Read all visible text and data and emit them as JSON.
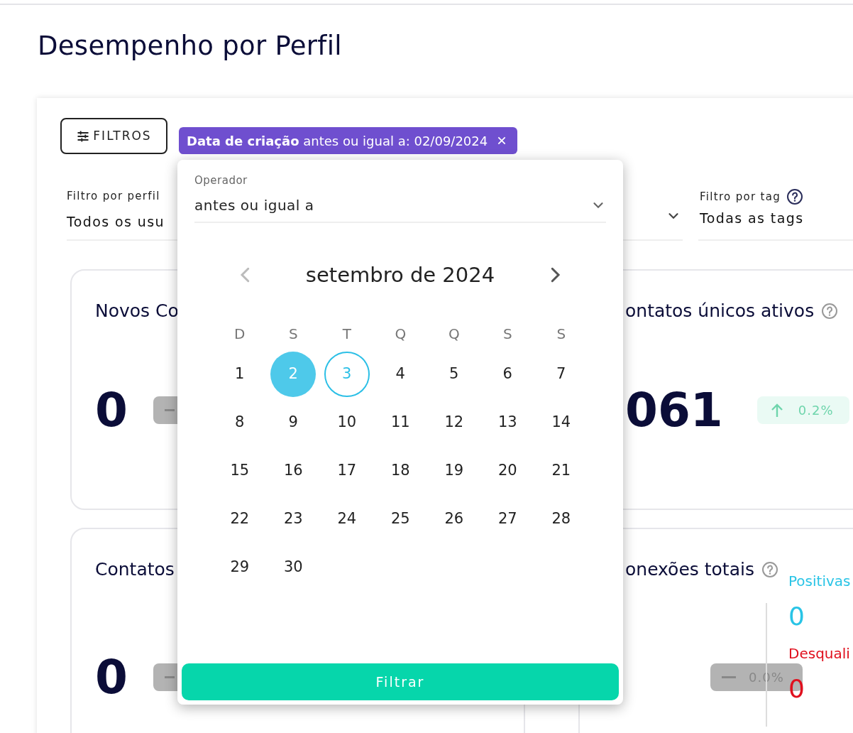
{
  "page_title": "Desempenho por Perfil",
  "filters_button": {
    "label": "FILTROS"
  },
  "active_filter": {
    "text": "**Data de criação** antes ou igual a: 02/09/2024"
  },
  "profile_filter": {
    "label": "Filtro por perfil",
    "value": "Todos os usu"
  },
  "tag_filter": {
    "label": "Filtro por tag",
    "value": "Todas as tags",
    "help": true
  },
  "cards": [
    {
      "title": "Novos Co",
      "help": false,
      "value": "0",
      "change": {
        "kind": "flat"
      }
    },
    {
      "title": "ontatos únicos ativos",
      "help": true,
      "value": "061",
      "change": {
        "kind": "up",
        "text": "0.2%"
      }
    },
    {
      "title": "Contatos",
      "help": false,
      "value": "0",
      "change": {
        "kind": "flat"
      }
    },
    {
      "title": "onexões totais",
      "help": true,
      "change": {
        "kind": "flat",
        "text": "0.0%"
      },
      "breakdown": [
        {
          "label": "Positivas",
          "value": "0",
          "color": "#29c4e6"
        },
        {
          "label": "Desquali",
          "value": "0",
          "color": "#e0101e"
        }
      ]
    }
  ],
  "date_popover": {
    "operator_label": "Operador",
    "operator_value": "antes ou igual a",
    "month": "setembro de 2024",
    "prev_disabled": true,
    "weekdays": [
      "D",
      "S",
      "T",
      "Q",
      "Q",
      "S",
      "S"
    ],
    "days": [
      {
        "label": "1",
        "selected": false,
        "today": false
      },
      {
        "label": "2",
        "selected": true,
        "today": false
      },
      {
        "label": "3",
        "selected": false,
        "today": true
      },
      {
        "label": "4",
        "selected": false,
        "today": false
      },
      {
        "label": "5",
        "selected": false,
        "today": false
      },
      {
        "label": "6",
        "selected": false,
        "today": false
      },
      {
        "label": "7",
        "selected": false,
        "today": false
      },
      {
        "label": "8",
        "selected": false,
        "today": false
      },
      {
        "label": "9",
        "selected": false,
        "today": false
      },
      {
        "label": "10",
        "selected": false,
        "today": false
      },
      {
        "label": "11",
        "selected": false,
        "today": false
      },
      {
        "label": "12",
        "selected": false,
        "today": false
      },
      {
        "label": "13",
        "selected": false,
        "today": false
      },
      {
        "label": "14",
        "selected": false,
        "today": false
      },
      {
        "label": "15",
        "selected": false,
        "today": false
      },
      {
        "label": "16",
        "selected": false,
        "today": false
      },
      {
        "label": "17",
        "selected": false,
        "today": false
      },
      {
        "label": "18",
        "selected": false,
        "today": false
      },
      {
        "label": "19",
        "selected": false,
        "today": false
      },
      {
        "label": "20",
        "selected": false,
        "today": false
      },
      {
        "label": "21",
        "selected": false,
        "today": false
      },
      {
        "label": "22",
        "selected": false,
        "today": false
      },
      {
        "label": "23",
        "selected": false,
        "today": false
      },
      {
        "label": "24",
        "selected": false,
        "today": false
      },
      {
        "label": "25",
        "selected": false,
        "today": false
      },
      {
        "label": "26",
        "selected": false,
        "today": false
      },
      {
        "label": "27",
        "selected": false,
        "today": false
      },
      {
        "label": "28",
        "selected": false,
        "today": false
      },
      {
        "label": "29",
        "selected": false,
        "today": false
      },
      {
        "label": "30",
        "selected": false,
        "today": false
      }
    ],
    "submit": "Filtrar"
  }
}
